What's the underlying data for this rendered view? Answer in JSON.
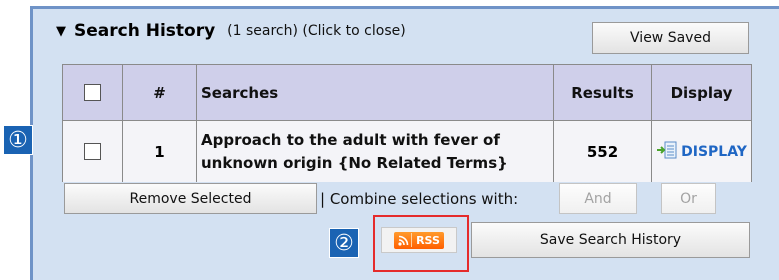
{
  "header": {
    "title": "Search History",
    "subtitle": "(1 search)  (Click to close)",
    "view_saved_label": "View Saved"
  },
  "table": {
    "columns": [
      "",
      "#",
      "Searches",
      "Results",
      "Display"
    ],
    "rows": [
      {
        "index": "1",
        "search": "Approach to the adult with fever of unknown origin {No Related Terms}",
        "results": "552",
        "display_label": "DISPLAY"
      }
    ]
  },
  "actions": {
    "remove_selected_label": "Remove Selected",
    "combine_label": "| Combine selections with:",
    "and_label": "And",
    "or_label": "Or",
    "rss_label": "RSS",
    "save_history_label": "Save Search History"
  },
  "callouts": {
    "one": "①",
    "two": "②"
  },
  "colors": {
    "panel_bg": "#d3e1f2",
    "panel_border": "#6f93c7",
    "header_row_bg": "#cfcfea",
    "callout_bg": "#1a63b3",
    "highlight_border": "#e52b2b",
    "rss_orange": "#ff7a00",
    "display_link": "#1f66c4"
  },
  "icons": {
    "collapse": "triangle-down-icon",
    "display": "document-arrow-icon",
    "rss": "rss-feed-icon"
  }
}
